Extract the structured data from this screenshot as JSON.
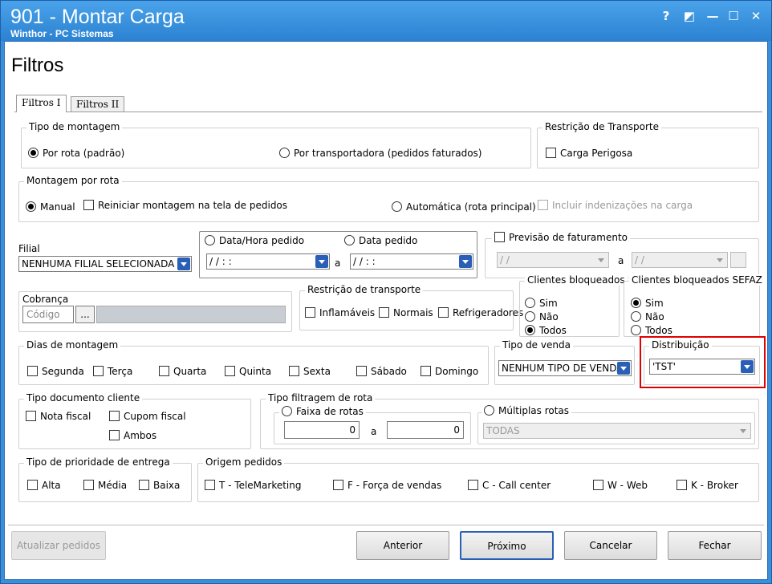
{
  "window": {
    "title": "901 - Montar Carga",
    "subtitle": "Winthor - PC Sistemas",
    "help": "?",
    "restore": "◩",
    "minimize": "—",
    "maximize": "☐",
    "close": "✕"
  },
  "page": {
    "title": "Filtros"
  },
  "tabs": [
    {
      "label": "Filtros I"
    },
    {
      "label": "Filtros II"
    }
  ],
  "tipo_montagem": {
    "legend": "Tipo de montagem",
    "rota": "Por rota (padrão)",
    "transportadora": "Por transportadora (pedidos faturados)"
  },
  "restricao_transp": {
    "legend": "Restrição de Transporte",
    "carga_perigosa": "Carga Perigosa"
  },
  "montagem_rota": {
    "legend": "Montagem por rota",
    "manual": "Manual",
    "reiniciar": "Reiniciar montagem na tela de pedidos",
    "automatica": "Automática (rota principal)",
    "incluir": "Incluir indenizações na carga"
  },
  "filial": {
    "label": "Filial",
    "value": "NENHUMA FILIAL SELECIONADA"
  },
  "datas": {
    "data_hora": "Data/Hora pedido",
    "data_pedido": "Data pedido",
    "from": " / /       : :",
    "to": " / /       : :",
    "a": "a"
  },
  "previsao": {
    "label": "Previsão de faturamento",
    "from": " / /",
    "to": " / /",
    "a": "a"
  },
  "cobranca": {
    "label": "Cobrança",
    "placeholder": "Código",
    "ellipsis": "..."
  },
  "restricao": {
    "legend": "Restrição de transporte",
    "inflamaveis": "Inflamáveis",
    "normais": "Normais",
    "refrigeradores": "Refrigeradores"
  },
  "clientes_bloq": {
    "legend": "Clientes bloqueados",
    "sim": "Sim",
    "nao": "Não",
    "todos": "Todos"
  },
  "clientes_sefaz": {
    "legend": "Clientes bloqueados SEFAZ",
    "sim": "Sim",
    "nao": "Não",
    "todos": "Todos"
  },
  "dias": {
    "legend": "Dias de montagem",
    "items": [
      "Segunda",
      "Terça",
      "Quarta",
      "Quinta",
      "Sexta",
      "Sábado",
      "Domingo"
    ]
  },
  "tipo_venda": {
    "legend": "Tipo de venda",
    "value": "NENHUM TIPO DE VENDA"
  },
  "distribuicao": {
    "legend": "Distribuição",
    "value": "'TST'"
  },
  "tipo_doc": {
    "legend": "Tipo documento cliente",
    "nota": "Nota fiscal",
    "cupom": "Cupom fiscal",
    "ambos": "Ambos"
  },
  "filtragem": {
    "legend": "Tipo filtragem de rota",
    "faixa": "Faixa de rotas",
    "from": "0",
    "to": "0",
    "a": "a",
    "multiplas": "Múltiplas rotas",
    "multi_value": "TODAS"
  },
  "prioridade": {
    "legend": "Tipo de prioridade de  entrega",
    "alta": "Alta",
    "media": "Média",
    "baixa": "Baixa"
  },
  "origem": {
    "legend": "Origem pedidos",
    "items": [
      "T - TeleMarketing",
      "F - Força de vendas",
      "C - Call center",
      "W - Web",
      "K - Broker"
    ]
  },
  "buttons": {
    "atualizar": "Atualizar pedidos",
    "anterior": "Anterior",
    "proximo": "Próximo",
    "cancelar": "Cancelar",
    "fechar": "Fechar"
  },
  "colors": {
    "title_bar": "#3b8fd9",
    "highlight": "#e00000",
    "combo_arrow": "#2a5fb8"
  }
}
